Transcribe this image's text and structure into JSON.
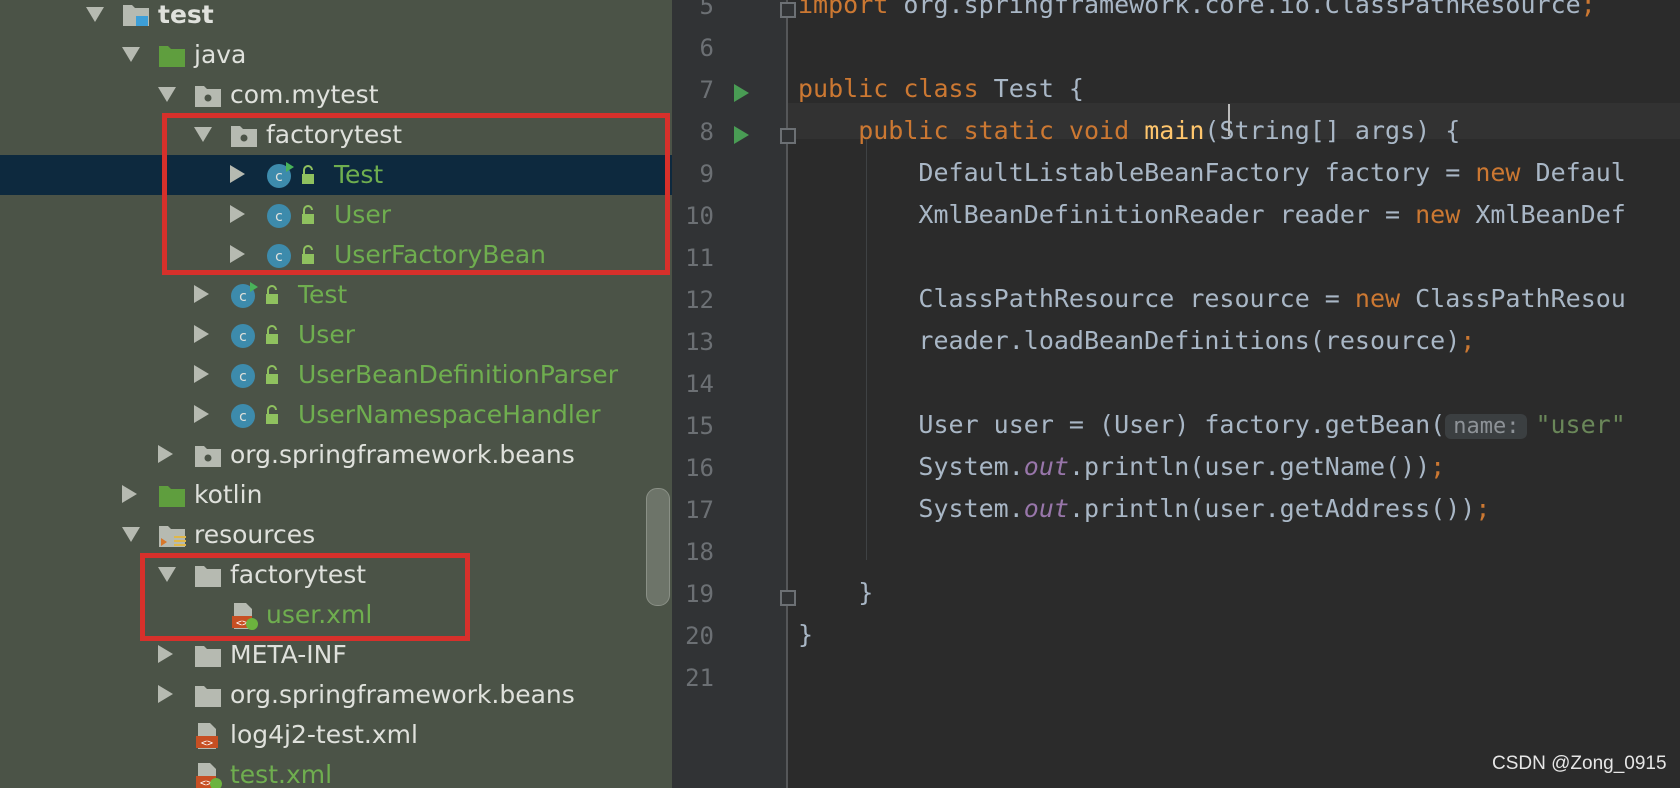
{
  "project_tree": {
    "nodes": [
      {
        "label": "test",
        "kind": "module",
        "state": "open",
        "style": "bold"
      },
      {
        "label": "java",
        "kind": "source-folder",
        "state": "open",
        "style": "normal"
      },
      {
        "label": "com.mytest",
        "kind": "package",
        "state": "open",
        "style": "normal"
      },
      {
        "label": "factorytest",
        "kind": "package",
        "state": "open",
        "style": "normal"
      },
      {
        "label": "Test",
        "kind": "class-runnable",
        "state": "closed",
        "style": "green"
      },
      {
        "label": "User",
        "kind": "class",
        "state": "closed",
        "style": "green"
      },
      {
        "label": "UserFactoryBean",
        "kind": "class",
        "state": "closed",
        "style": "green"
      },
      {
        "label": "Test",
        "kind": "class-runnable",
        "state": "closed",
        "style": "green"
      },
      {
        "label": "User",
        "kind": "class",
        "state": "closed",
        "style": "green"
      },
      {
        "label": "UserBeanDefinitionParser",
        "kind": "class",
        "state": "closed",
        "style": "green"
      },
      {
        "label": "UserNamespaceHandler",
        "kind": "class",
        "state": "closed",
        "style": "green"
      },
      {
        "label": "org.springframework.beans",
        "kind": "package",
        "state": "closed",
        "style": "normal"
      },
      {
        "label": "kotlin",
        "kind": "source-folder",
        "state": "closed",
        "style": "normal"
      },
      {
        "label": "resources",
        "kind": "resources-folder",
        "state": "open",
        "style": "normal"
      },
      {
        "label": "factorytest",
        "kind": "folder",
        "state": "open",
        "style": "normal"
      },
      {
        "label": "user.xml",
        "kind": "spring-xml",
        "state": "none",
        "style": "green"
      },
      {
        "label": "META-INF",
        "kind": "folder",
        "state": "closed",
        "style": "normal"
      },
      {
        "label": "org.springframework.beans",
        "kind": "folder",
        "state": "closed",
        "style": "normal"
      },
      {
        "label": "log4j2-test.xml",
        "kind": "xml-file",
        "state": "none",
        "style": "normal"
      },
      {
        "label": "test.xml",
        "kind": "spring-xml",
        "state": "none",
        "style": "green"
      }
    ],
    "selected_index": 4
  },
  "editor": {
    "line_numbers": [
      "5",
      "6",
      "7",
      "8",
      "9",
      "10",
      "11",
      "12",
      "13",
      "14",
      "15",
      "16",
      "17",
      "18",
      "19",
      "20",
      "21"
    ],
    "run_markers_on_lines": [
      "7",
      "8"
    ],
    "lines": [
      {
        "n": "5",
        "tokens": [
          [
            "kw",
            "import "
          ],
          [
            "",
            "org.springframework.core.io.ClassPathResource"
          ],
          [
            "kw",
            ";"
          ]
        ]
      },
      {
        "n": "6",
        "tokens": []
      },
      {
        "n": "7",
        "tokens": [
          [
            "kw",
            "public class "
          ],
          [
            "",
            "Test {"
          ]
        ]
      },
      {
        "n": "8",
        "tokens": [
          [
            "kw",
            "    public static void "
          ],
          [
            "fn",
            "main"
          ],
          [
            "",
            "(String[] args) {"
          ]
        ]
      },
      {
        "n": "9",
        "tokens": [
          [
            "",
            "        DefaultListableBeanFactory factory = "
          ],
          [
            "kw",
            "new "
          ],
          [
            "",
            "Defaul"
          ]
        ]
      },
      {
        "n": "10",
        "tokens": [
          [
            "",
            "        XmlBeanDefinitionReader reader = "
          ],
          [
            "kw",
            "new "
          ],
          [
            "",
            "XmlBeanDef"
          ]
        ]
      },
      {
        "n": "11",
        "tokens": []
      },
      {
        "n": "12",
        "tokens": [
          [
            "",
            "        ClassPathResource resource = "
          ],
          [
            "kw",
            "new "
          ],
          [
            "",
            "ClassPathResou"
          ]
        ]
      },
      {
        "n": "13",
        "tokens": [
          [
            "",
            "        reader.loadBeanDefinitions(resource)"
          ],
          [
            "kw",
            ";"
          ]
        ]
      },
      {
        "n": "14",
        "tokens": []
      },
      {
        "n": "15",
        "tokens": [
          [
            "",
            "        User user = (User) factory.getBean("
          ],
          [
            "hint",
            "name:"
          ],
          [
            "str",
            "\"user\""
          ]
        ]
      },
      {
        "n": "16",
        "tokens": [
          [
            "",
            "        System."
          ],
          [
            "st",
            "out"
          ],
          [
            "",
            ".println(user.getName())"
          ],
          [
            "kw",
            ";"
          ]
        ]
      },
      {
        "n": "17",
        "tokens": [
          [
            "",
            "        System."
          ],
          [
            "st",
            "out"
          ],
          [
            "",
            ".println(user.getAddress())"
          ],
          [
            "kw",
            ";"
          ]
        ]
      },
      {
        "n": "18",
        "tokens": []
      },
      {
        "n": "19",
        "tokens": [
          [
            "",
            "    }"
          ]
        ]
      },
      {
        "n": "20",
        "tokens": [
          [
            "",
            "}"
          ]
        ]
      },
      {
        "n": "21",
        "tokens": []
      }
    ]
  },
  "watermark": "CSDN @Zong_0915",
  "colors": {
    "highlight_box": "#d7302b",
    "tree_bg": "#4b5347",
    "editor_bg": "#2b2b2b",
    "selection": "#0d293e"
  }
}
